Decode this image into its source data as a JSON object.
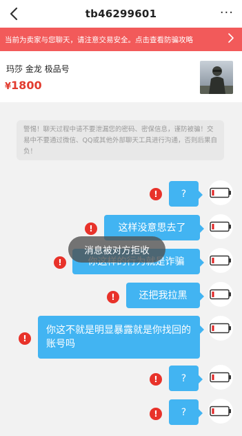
{
  "header": {
    "back_icon": "chevron-left-icon",
    "title": "tb46299601",
    "more_icon": "more-horizontal-icon",
    "more_label": "···"
  },
  "banner": {
    "text": "当前为卖家与您聊天，请注意交易安全。点击查看防骗攻略",
    "chevron_icon": "chevron-right-icon",
    "background": "#f25a5a"
  },
  "product": {
    "name": "玛莎 金龙 极品号",
    "currency": "¥",
    "price": "1800",
    "price_color": "#e23b2e",
    "thumbnail_icon": "product-thumbnail-image"
  },
  "system_notice": {
    "text": "警惕！聊天过程中请不要泄漏您的密码、密保信息，谨防被骗！交易中不要通过微信、QQ或其他外部聊天工具进行沟通，否则后果自负！"
  },
  "messages": [
    {
      "text": "?",
      "status": "failed",
      "status_icon": "error-icon"
    },
    {
      "text": "这样没意思去了",
      "status": "failed",
      "status_icon": "error-icon"
    },
    {
      "text": "你这样的行为就是诈骗",
      "status": "failed",
      "status_icon": "error-icon"
    },
    {
      "text": "还把我拉黑",
      "status": "failed",
      "status_icon": "error-icon"
    },
    {
      "text": "你这不就是明显暴露就是你找回的账号吗",
      "status": "failed",
      "status_icon": "error-icon"
    },
    {
      "text": "?",
      "status": "failed",
      "status_icon": "error-icon"
    },
    {
      "text": "?",
      "status": "failed",
      "status_icon": "error-icon"
    }
  ],
  "error_mark": "!",
  "bubble_color": "#42b4f2",
  "error_color": "#e8322a",
  "avatar_icon": "battery-low-avatar-icon",
  "toast": {
    "text": "消息被对方拒收"
  }
}
